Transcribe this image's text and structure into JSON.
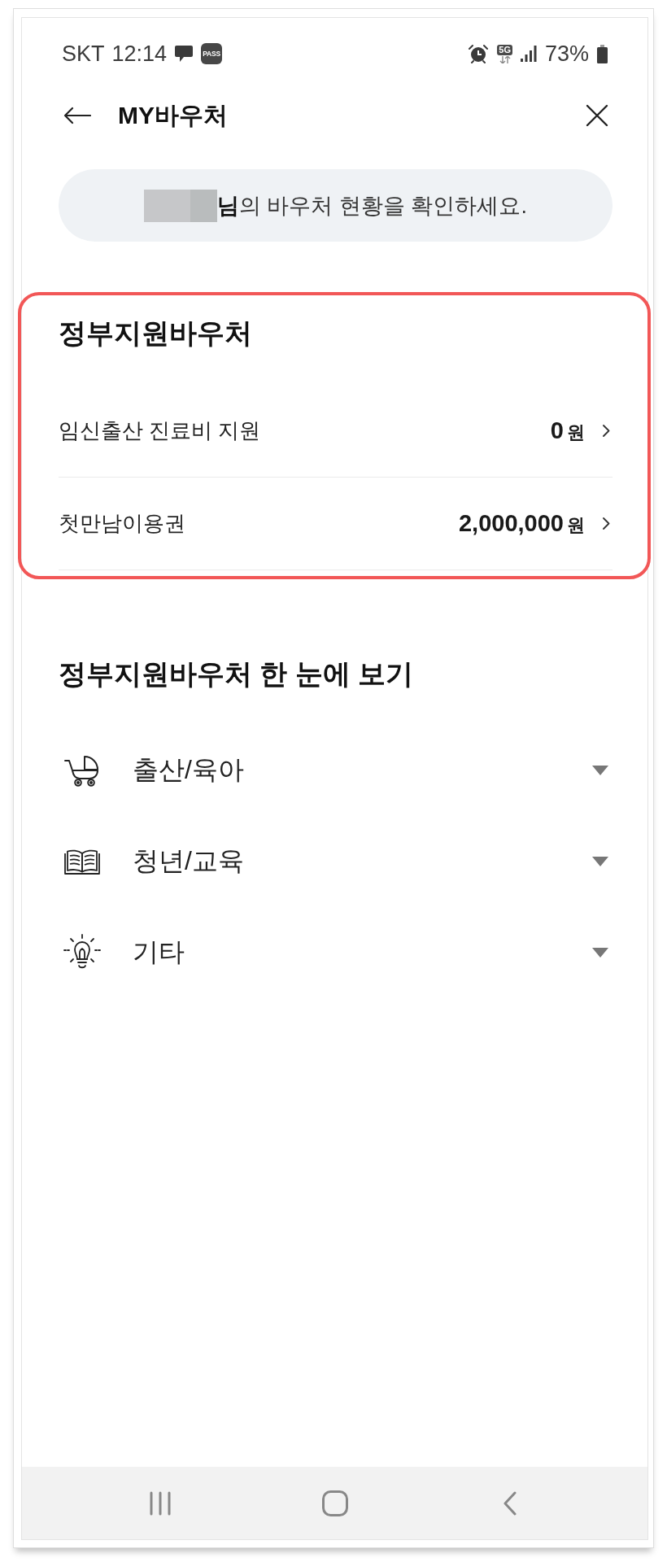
{
  "status_bar": {
    "carrier": "SKT",
    "time": "12:14",
    "badge": "PASS",
    "network": "5G",
    "battery": "73%"
  },
  "header": {
    "title": "MY바우처"
  },
  "banner": {
    "name_hidden": true,
    "text": "**님**의 바우처 현황을 확인하세요."
  },
  "vouchers": {
    "title": "정부지원바우처",
    "highlighted": true,
    "items": [
      {
        "name": "임신출산 진료비 지원",
        "amount": "0",
        "unit": "원"
      },
      {
        "name": "첫만남이용권",
        "amount": "2,000,000",
        "unit": "원"
      }
    ]
  },
  "categories": {
    "title": "정부지원바우처 한 눈에 보기",
    "items": [
      {
        "kind": "stroller",
        "label": "출산/육아",
        "expanded": false
      },
      {
        "kind": "book",
        "label": "청년/교육",
        "expanded": false
      },
      {
        "kind": "bulb",
        "label": "기타",
        "expanded": false
      }
    ]
  }
}
